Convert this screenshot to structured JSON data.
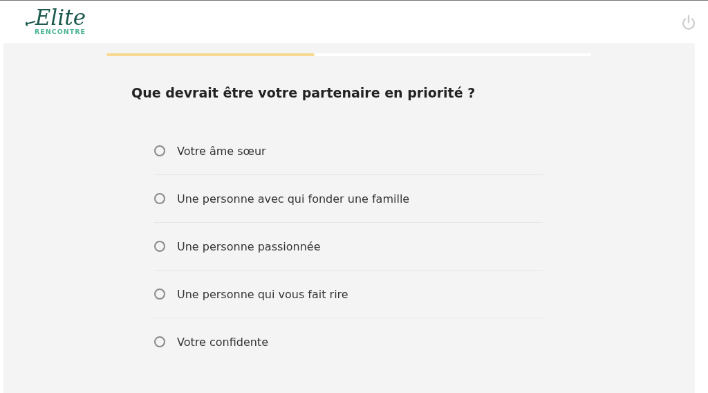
{
  "header": {
    "logo": {
      "name": "Elite",
      "tagline": "RENCONTRE"
    }
  },
  "progress": {
    "level": 0.43
  },
  "question": "Que devrait être votre partenaire en priorité ?",
  "options": [
    {
      "label": "Votre âme sœur",
      "selected": false
    },
    {
      "label": "Une personne avec qui fonder une famille",
      "selected": false
    },
    {
      "label": "Une personne passionnée",
      "selected": false
    },
    {
      "label": "Une personne qui vous fait rire",
      "selected": false
    },
    {
      "label": "Votre confidente",
      "selected": false
    }
  ]
}
